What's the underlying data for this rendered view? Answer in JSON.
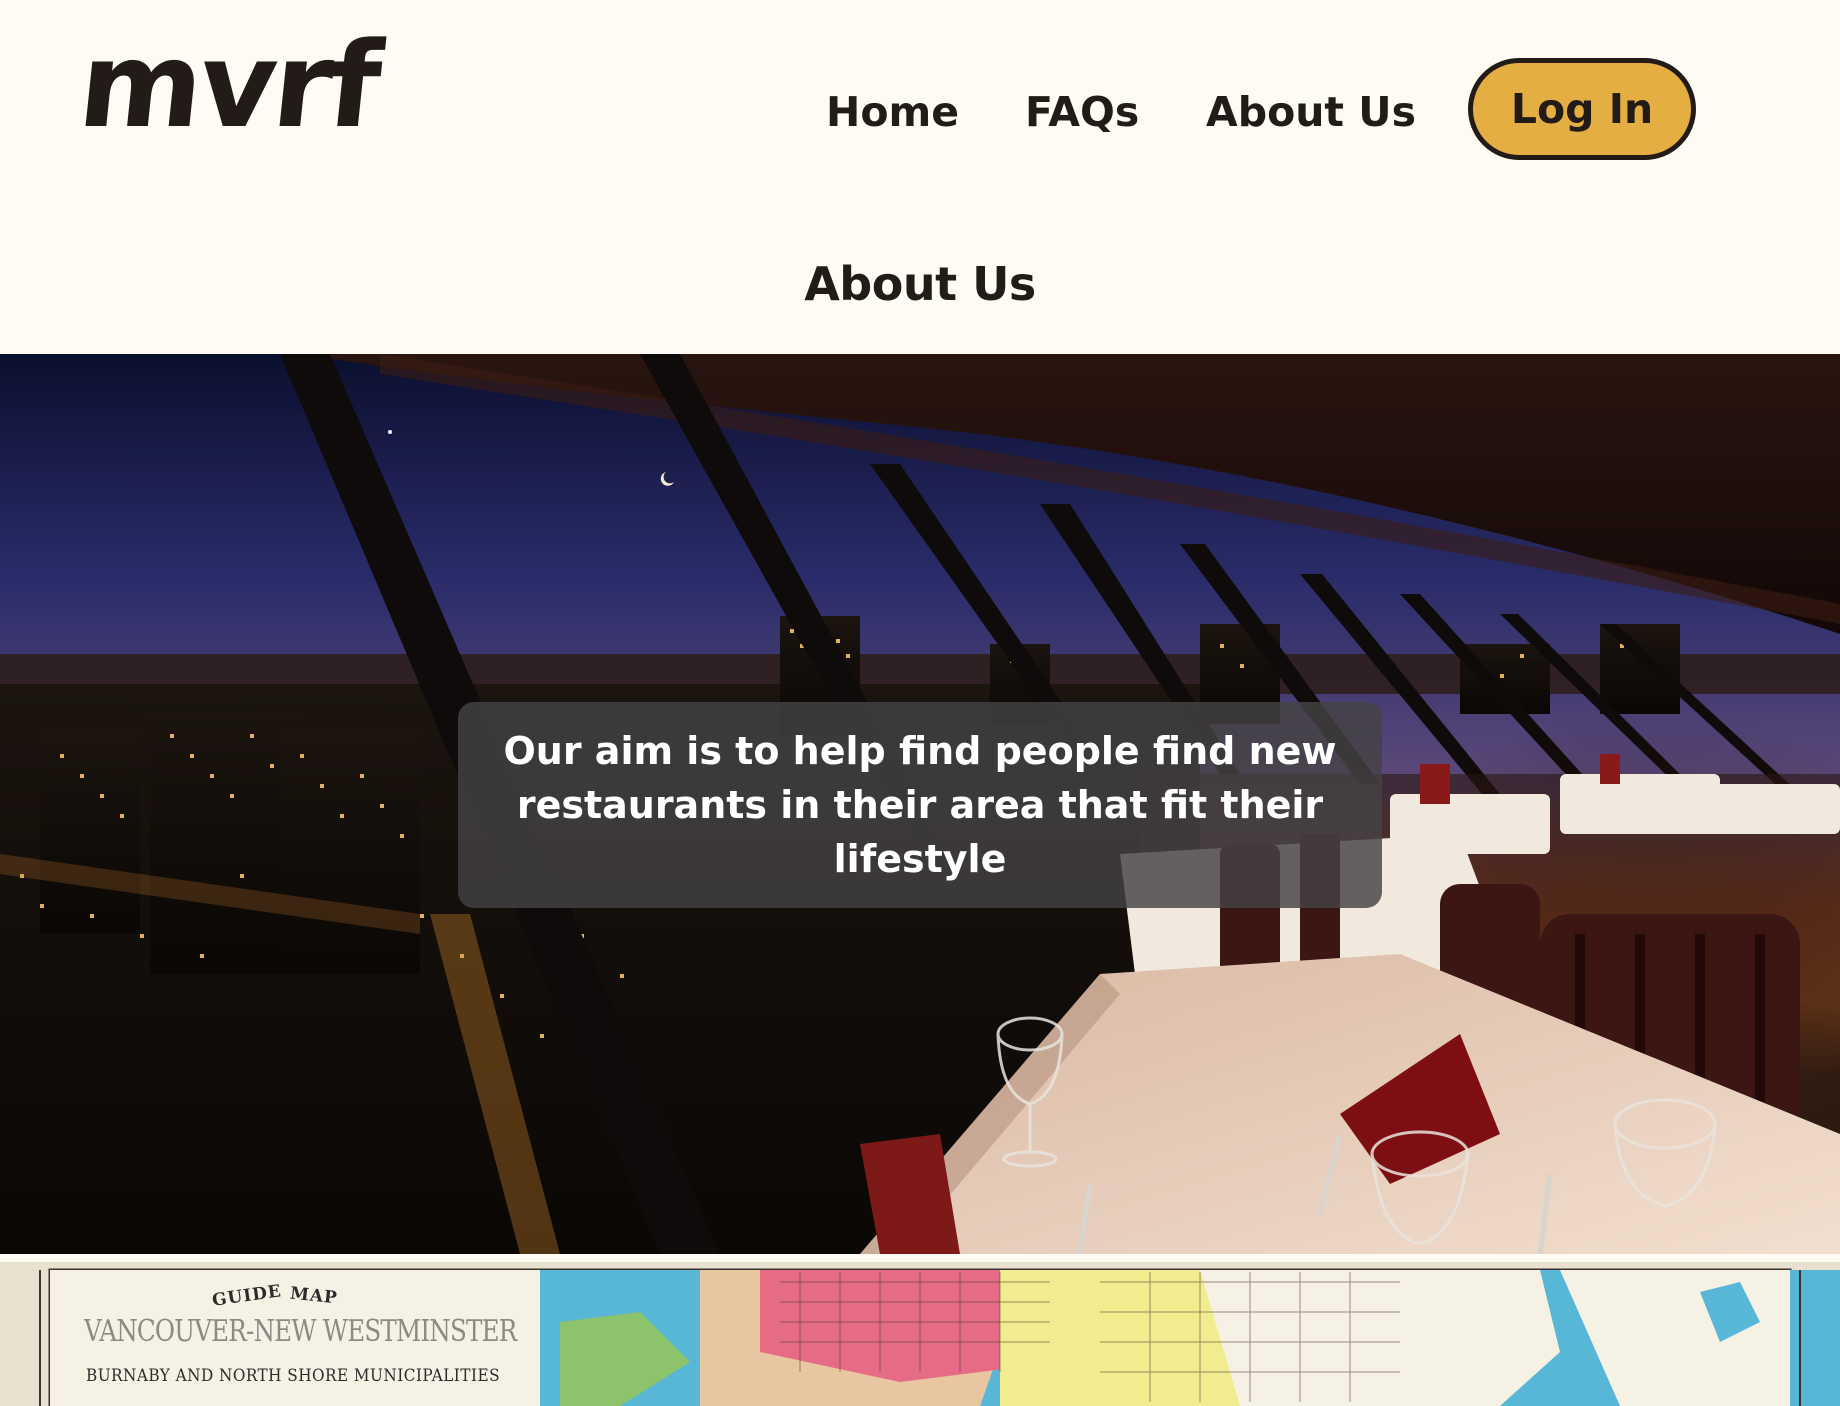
{
  "brand": {
    "logo_text": "mvrf"
  },
  "nav": {
    "items": [
      {
        "label": "Home"
      },
      {
        "label": "FAQs"
      },
      {
        "label": "About Us"
      }
    ],
    "login_label": "Log In"
  },
  "page": {
    "title": "About Us"
  },
  "hero": {
    "image": "restaurant-night-city-view",
    "caption": "Our aim is to help find people find new restaurants in their area that fit their lifestyle"
  },
  "map": {
    "image": "vintage-vancouver-guide-map",
    "guide_label": "GUIDE",
    "map_label": "MAP",
    "title": "VANCOUVER-NEW WESTMINSTER",
    "subtitle": "BURNABY AND NORTH SHORE MUNICIPALITIES"
  },
  "colors": {
    "page_bg": "#fdfbf4",
    "text_dark": "#231b17",
    "login_bg": "#e5ae43",
    "caption_bg": "#444244"
  }
}
